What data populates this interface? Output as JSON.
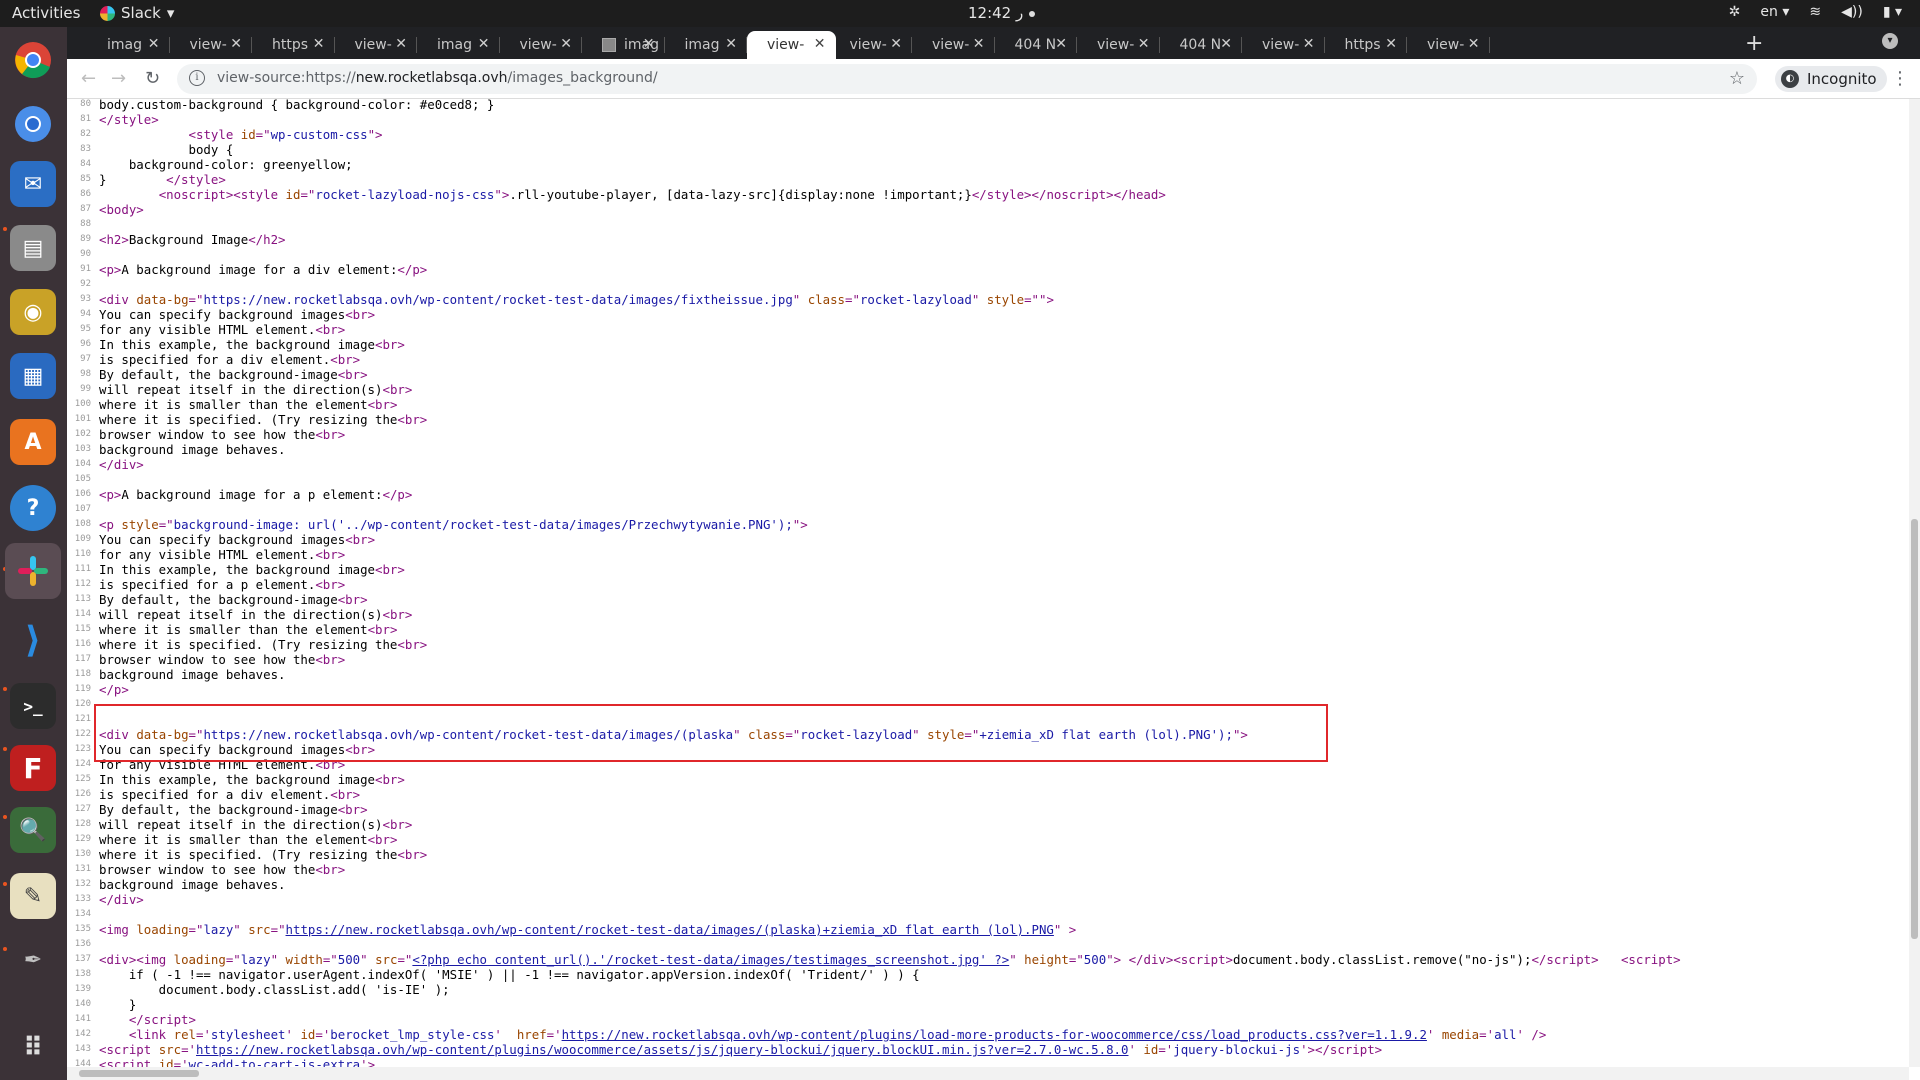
{
  "topbar": {
    "activities": "Activities",
    "app_name": "Slack",
    "clock": "12:42 ر",
    "language": "en"
  },
  "tabs": [
    {
      "label": "imag",
      "active": false
    },
    {
      "label": "view-",
      "active": false
    },
    {
      "label": "https",
      "active": false
    },
    {
      "label": "view-",
      "active": false
    },
    {
      "label": "imag",
      "active": false
    },
    {
      "label": "view-",
      "active": false
    },
    {
      "label": "imag",
      "active": false,
      "favicon": true
    },
    {
      "label": "imag",
      "active": false
    },
    {
      "label": "view-",
      "active": true
    },
    {
      "label": "view-",
      "active": false
    },
    {
      "label": "view-",
      "active": false
    },
    {
      "label": "404 N",
      "active": false
    },
    {
      "label": "view-",
      "active": false
    },
    {
      "label": "404 N",
      "active": false
    },
    {
      "label": "view-",
      "active": false
    },
    {
      "label": "https",
      "active": false
    },
    {
      "label": "view-",
      "active": false
    }
  ],
  "address": {
    "prefix": "view-source:https://",
    "host": "new.rocketlabsqa.ovh",
    "path": "/images_background/"
  },
  "incognito_label": "Incognito",
  "source_lines": [
    {
      "n": "80",
      "html": "body.custom-background { background-color: #e0ced8; }"
    },
    {
      "n": "81",
      "html": "<span class=\"tag\">&lt;/style&gt;</span>"
    },
    {
      "n": "82",
      "html": "            <span class=\"tag\">&lt;style <span class=\"attr\">id</span>=\"<span class=\"val\">wp-custom-css</span>\"&gt;</span>"
    },
    {
      "n": "83",
      "html": "            body {"
    },
    {
      "n": "84",
      "html": "    background-color: greenyellow;"
    },
    {
      "n": "85",
      "html": "}        <span class=\"tag\">&lt;/style&gt;</span>"
    },
    {
      "n": "86",
      "html": "        <span class=\"tag\">&lt;noscript&gt;</span><span class=\"tag\">&lt;style <span class=\"attr\">id</span>=\"<span class=\"val\">rocket-lazyload-nojs-css</span>\"&gt;</span>.rll-youtube-player, [data-lazy-src]{display:none !important;}<span class=\"tag\">&lt;/style&gt;</span><span class=\"tag\">&lt;/noscript&gt;</span><span class=\"tag\">&lt;/head&gt;</span>"
    },
    {
      "n": "87",
      "html": "<span class=\"tag\">&lt;body&gt;</span>"
    },
    {
      "n": "88",
      "html": ""
    },
    {
      "n": "89",
      "html": "<span class=\"tag\">&lt;h2&gt;</span>Background Image<span class=\"tag\">&lt;/h2&gt;</span>"
    },
    {
      "n": "90",
      "html": ""
    },
    {
      "n": "91",
      "html": "<span class=\"tag\">&lt;p&gt;</span>A background image for a div element:<span class=\"tag\">&lt;/p&gt;</span>"
    },
    {
      "n": "92",
      "html": ""
    },
    {
      "n": "93",
      "html": "<span class=\"tag\">&lt;div <span class=\"attr\">data-bg</span>=\"<span class=\"val\">https://new.rocketlabsqa.ovh/wp-content/rocket-test-data/images/fixtheissue.jpg</span>\" <span class=\"attr\">class</span>=\"<span class=\"val\">rocket-lazyload</span>\" <span class=\"attr\">style</span>=\"\"&gt;</span>"
    },
    {
      "n": "94",
      "html": "You can specify background images<span class=\"tag\">&lt;br&gt;</span>"
    },
    {
      "n": "95",
      "html": "for any visible HTML element.<span class=\"tag\">&lt;br&gt;</span>"
    },
    {
      "n": "96",
      "html": "In this example, the background image<span class=\"tag\">&lt;br&gt;</span>"
    },
    {
      "n": "97",
      "html": "is specified for a div element.<span class=\"tag\">&lt;br&gt;</span>"
    },
    {
      "n": "98",
      "html": "By default, the background-image<span class=\"tag\">&lt;br&gt;</span>"
    },
    {
      "n": "99",
      "html": "will repeat itself in the direction(s)<span class=\"tag\">&lt;br&gt;</span>"
    },
    {
      "n": "100",
      "html": "where it is smaller than the element<span class=\"tag\">&lt;br&gt;</span>"
    },
    {
      "n": "101",
      "html": "where it is specified. (Try resizing the<span class=\"tag\">&lt;br&gt;</span>"
    },
    {
      "n": "102",
      "html": "browser window to see how the<span class=\"tag\">&lt;br&gt;</span>"
    },
    {
      "n": "103",
      "html": "background image behaves."
    },
    {
      "n": "104",
      "html": "<span class=\"tag\">&lt;/div&gt;</span>"
    },
    {
      "n": "105",
      "html": ""
    },
    {
      "n": "106",
      "html": "<span class=\"tag\">&lt;p&gt;</span>A background image for a p element:<span class=\"tag\">&lt;/p&gt;</span>"
    },
    {
      "n": "107",
      "html": ""
    },
    {
      "n": "108",
      "html": "<span class=\"tag\">&lt;p <span class=\"attr\">style</span>=\"<span class=\"val\">background-image: url('../wp-content/rocket-test-data/images/Przechwytywanie.PNG');</span>\"&gt;</span>"
    },
    {
      "n": "109",
      "html": "You can specify background images<span class=\"tag\">&lt;br&gt;</span>"
    },
    {
      "n": "110",
      "html": "for any visible HTML element.<span class=\"tag\">&lt;br&gt;</span>"
    },
    {
      "n": "111",
      "html": "In this example, the background image<span class=\"tag\">&lt;br&gt;</span>"
    },
    {
      "n": "112",
      "html": "is specified for a p element.<span class=\"tag\">&lt;br&gt;</span>"
    },
    {
      "n": "113",
      "html": "By default, the background-image<span class=\"tag\">&lt;br&gt;</span>"
    },
    {
      "n": "114",
      "html": "will repeat itself in the direction(s)<span class=\"tag\">&lt;br&gt;</span>"
    },
    {
      "n": "115",
      "html": "where it is smaller than the element<span class=\"tag\">&lt;br&gt;</span>"
    },
    {
      "n": "116",
      "html": "where it is specified. (Try resizing the<span class=\"tag\">&lt;br&gt;</span>"
    },
    {
      "n": "117",
      "html": "browser window to see how the<span class=\"tag\">&lt;br&gt;</span>"
    },
    {
      "n": "118",
      "html": "background image behaves."
    },
    {
      "n": "119",
      "html": "<span class=\"tag\">&lt;/p&gt;</span>"
    },
    {
      "n": "120",
      "html": ""
    },
    {
      "n": "121",
      "html": ""
    },
    {
      "n": "122",
      "html": "<span class=\"tag\">&lt;div <span class=\"attr\">data-bg</span>=\"<span class=\"val\">https://new.rocketlabsqa.ovh/wp-content/rocket-test-data/images/(plaska</span>\" <span class=\"attr\">class</span>=\"<span class=\"val\">rocket-lazyload</span>\" <span class=\"attr\">style</span>=\"<span class=\"val\">+ziemia_xD flat earth (lol).PNG');</span>\"&gt;</span>"
    },
    {
      "n": "123",
      "html": "You can specify background images<span class=\"tag\">&lt;br&gt;</span>"
    },
    {
      "n": "124",
      "html": "for any visible HTML element.<span class=\"tag\">&lt;br&gt;</span>"
    },
    {
      "n": "125",
      "html": "In this example, the background image<span class=\"tag\">&lt;br&gt;</span>"
    },
    {
      "n": "126",
      "html": "is specified for a div element.<span class=\"tag\">&lt;br&gt;</span>"
    },
    {
      "n": "127",
      "html": "By default, the background-image<span class=\"tag\">&lt;br&gt;</span>"
    },
    {
      "n": "128",
      "html": "will repeat itself in the direction(s)<span class=\"tag\">&lt;br&gt;</span>"
    },
    {
      "n": "129",
      "html": "where it is smaller than the element<span class=\"tag\">&lt;br&gt;</span>"
    },
    {
      "n": "130",
      "html": "where it is specified. (Try resizing the<span class=\"tag\">&lt;br&gt;</span>"
    },
    {
      "n": "131",
      "html": "browser window to see how the<span class=\"tag\">&lt;br&gt;</span>"
    },
    {
      "n": "132",
      "html": "background image behaves."
    },
    {
      "n": "133",
      "html": "<span class=\"tag\">&lt;/div&gt;</span>"
    },
    {
      "n": "134",
      "html": ""
    },
    {
      "n": "135",
      "html": "<span class=\"tag\">&lt;img <span class=\"attr\">loading</span>=\"<span class=\"val\">lazy</span>\" <span class=\"attr\">src</span>=\"<span class=\"lnk\">https://new.rocketlabsqa.ovh/wp-content/rocket-test-data/images/(plaska)+ziemia_xD flat earth (lol).PNG</span>\" &gt;</span>"
    },
    {
      "n": "136",
      "html": ""
    },
    {
      "n": "137",
      "html": "<span class=\"tag\">&lt;div&gt;</span><span class=\"tag\">&lt;img <span class=\"attr\">loading</span>=\"<span class=\"val\">lazy</span>\" <span class=\"attr\">width</span>=\"<span class=\"val\">500</span>\" <span class=\"attr\">src</span>=\"<span class=\"lnk\">&lt;?php echo content_url().'/rocket-test-data/images/testimages_screenshot.jpg' ?&gt;</span>\" <span class=\"attr\">height</span>=\"<span class=\"val\">500</span>\"&gt;</span> <span class=\"tag\">&lt;/div&gt;</span><span class=\"tag\">&lt;script&gt;</span>document.body.classList.remove(\"no-js\");<span class=\"tag\">&lt;/script&gt;</span>   <span class=\"tag\">&lt;script&gt;</span>"
    },
    {
      "n": "138",
      "html": "    if ( -1 !== navigator.userAgent.indexOf( 'MSIE' ) || -1 !== navigator.appVersion.indexOf( 'Trident/' ) ) {"
    },
    {
      "n": "139",
      "html": "        document.body.classList.add( 'is-IE' );"
    },
    {
      "n": "140",
      "html": "    }"
    },
    {
      "n": "141",
      "html": "    <span class=\"tag\">&lt;/script&gt;</span>"
    },
    {
      "n": "142",
      "html": "    <span class=\"tag\">&lt;link <span class=\"attr\">rel</span>='<span class=\"val\">stylesheet</span>' <span class=\"attr\">id</span>='<span class=\"val\">berocket_lmp_style-css</span>'  <span class=\"attr\">href</span>='<span class=\"lnk\">https://new.rocketlabsqa.ovh/wp-content/plugins/load-more-products-for-woocommerce/css/load_products.css?ver=1.1.9.2</span>' <span class=\"attr\">media</span>='<span class=\"val\">all</span>' /&gt;</span>"
    },
    {
      "n": "143",
      "html": "<span class=\"tag\">&lt;script <span class=\"attr\">src</span>='<span class=\"lnk\">https://new.rocketlabsqa.ovh/wp-content/plugins/woocommerce/assets/js/jquery-blockui/jquery.blockUI.min.js?ver=2.7.0-wc.5.8.0</span>' <span class=\"attr\">id</span>='<span class=\"val\">jquery-blockui-js</span>'&gt;</span><span class=\"tag\">&lt;/script&gt;</span>"
    },
    {
      "n": "144",
      "html": "<span class=\"tag\">&lt;script <span class=\"attr\">id</span>='<span class=\"val\">wc-add-to-cart-js-extra</span>'&gt;</span>"
    }
  ]
}
